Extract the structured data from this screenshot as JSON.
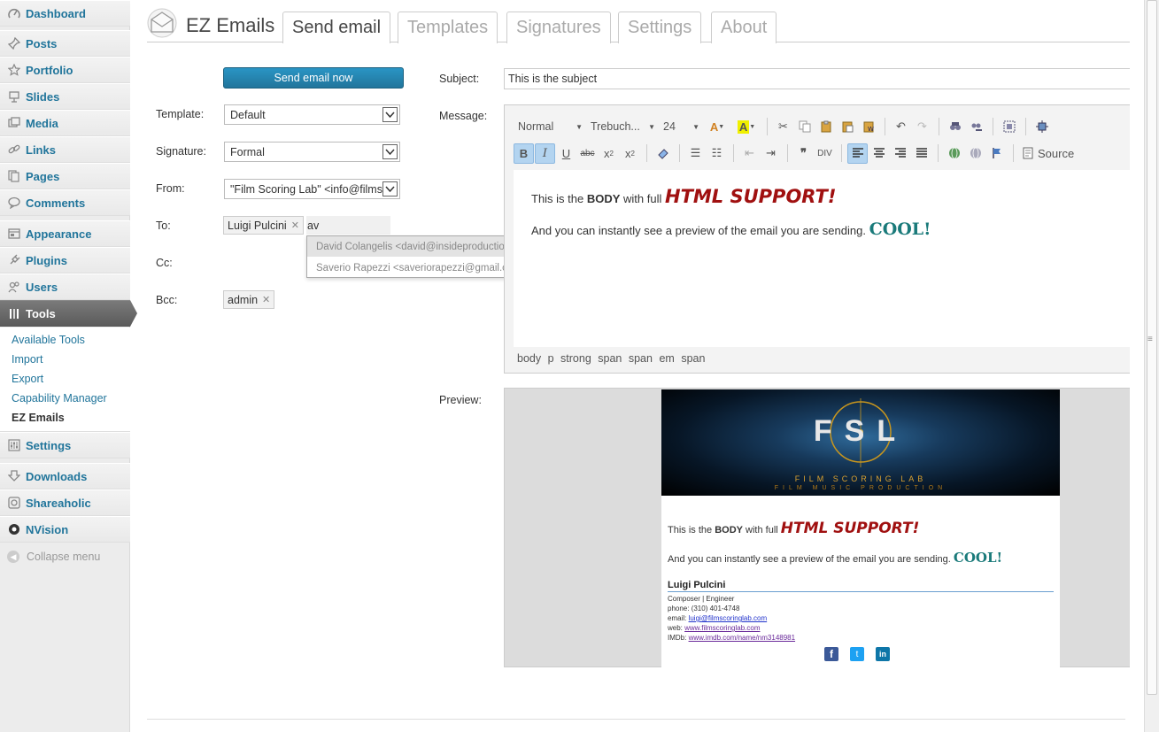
{
  "sidebar": {
    "items": [
      {
        "label": "Dashboard",
        "icon": "dashboard-icon"
      },
      {
        "label": "Posts",
        "icon": "pushpin-icon"
      },
      {
        "label": "Portfolio",
        "icon": "star-icon"
      },
      {
        "label": "Slides",
        "icon": "slides-icon"
      },
      {
        "label": "Media",
        "icon": "media-icon"
      },
      {
        "label": "Links",
        "icon": "link-icon"
      },
      {
        "label": "Pages",
        "icon": "pages-icon"
      },
      {
        "label": "Comments",
        "icon": "comment-icon"
      },
      {
        "label": "Appearance",
        "icon": "appearance-icon"
      },
      {
        "label": "Plugins",
        "icon": "plugin-icon"
      },
      {
        "label": "Users",
        "icon": "users-icon"
      },
      {
        "label": "Tools",
        "icon": "tools-icon"
      },
      {
        "label": "Settings",
        "icon": "settings-icon"
      },
      {
        "label": "Downloads",
        "icon": "download-icon"
      },
      {
        "label": "Shareaholic",
        "icon": "share-icon"
      },
      {
        "label": "NVision",
        "icon": "nvision-icon"
      }
    ],
    "tools_submenu": [
      "Available Tools",
      "Import",
      "Export",
      "Capability Manager",
      "EZ Emails"
    ],
    "collapse_label": "Collapse menu"
  },
  "header": {
    "title": "EZ Emails",
    "tabs": [
      "Send email",
      "Templates",
      "Signatures",
      "Settings",
      "About"
    ]
  },
  "form": {
    "send_button": "Send email now",
    "template_label": "Template:",
    "template_value": "Default",
    "signature_label": "Signature:",
    "signature_value": "Formal",
    "from_label": "From:",
    "from_value": "\"Film Scoring Lab\" <info@films",
    "to_label": "To:",
    "to_tokens": [
      "Luigi Pulcini"
    ],
    "to_typed": "av",
    "suggestions": [
      "David Colangelis <david@insideproductions.it>",
      "Saverio Rapezzi <saveriorapezzi@gmail.com>"
    ],
    "cc_label": "Cc:",
    "bcc_label": "Bcc:",
    "bcc_tokens": [
      "admin"
    ],
    "subject_label": "Subject:",
    "subject_value": "This is the subject",
    "message_label": "Message:",
    "preview_label": "Preview:"
  },
  "editor": {
    "format": "Normal",
    "font": "Trebuch...",
    "size": "24",
    "source_label": "Source",
    "body": {
      "line1_pre": "This is the ",
      "line1_bold": "BODY",
      "line1_mid": " with full ",
      "line1_big": "HTML SUPPORT!",
      "line2_pre": "And you can instantly see a preview of the email you are sending.",
      "line2_big": "COOL!"
    },
    "path": [
      "body",
      "p",
      "strong",
      "span",
      "span",
      "em",
      "span"
    ]
  },
  "preview": {
    "logo_text": "FSL",
    "logo_line1": "FILM SCORING LAB",
    "logo_line2": "FILM MUSIC PRODUCTION",
    "body_line1_pre": "This is the ",
    "body_line1_bold": "BODY",
    "body_line1_mid": " with full ",
    "body_line1_big": "HTML SUPPORT!",
    "body_line2_pre": "And you can instantly see a preview of the email you are sending.",
    "body_line2_big": "COOL!",
    "sig_name": "Luigi Pulcini",
    "sig_role": "Composer | Engineer",
    "sig_phone": "phone: (310) 401-4748",
    "sig_email_label": "email: ",
    "sig_email": "luigi@filmscoringlab.com",
    "sig_web_label": "web: ",
    "sig_web": "www.filmscoringlab.com",
    "sig_imdb_label": "IMDb: ",
    "sig_imdb": "www.imdb.com/name/nm3148981",
    "social": [
      "facebook-icon",
      "twitter-icon",
      "linkedin-icon"
    ]
  },
  "colors": {
    "link_blue": "#21759b",
    "button_blue": "#2a95c5",
    "accent_red": "#a01010",
    "accent_teal": "#1a7a7a"
  }
}
